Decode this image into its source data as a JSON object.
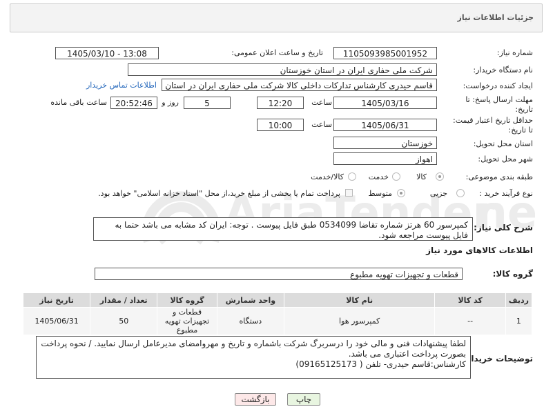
{
  "header": {
    "title": "جزئیات اطلاعات نیاز"
  },
  "fields": {
    "need_number_label": "شماره نیاز:",
    "need_number": "1105093985001952",
    "announce_label": "تاریخ و ساعت اعلان عمومی:",
    "announce_value": "1405/03/10 - 13:08",
    "buyer_org_label": "نام دستگاه خریدار:",
    "buyer_org": "شرکت ملی حفاری ایران در استان خوزستان",
    "creator_label": "ایجاد کننده درخواست:",
    "creator": "قاسم حیدری کارشناس تدارکات داخلی کالا شرکت ملی حفاری ایران در استان خوزستان",
    "contact_link": "اطلاعات تماس خریدار",
    "reply_deadline_label_1": "مهلت ارسال پاسخ: تا",
    "reply_deadline_label_2": "تاریخ:",
    "reply_date": "1405/03/16",
    "time_label": "ساعت",
    "reply_time": "12:20",
    "days_value": "5",
    "days_label": "روز و",
    "remaining_value": "20:52:46",
    "remaining_label": "ساعت باقی مانده",
    "price_validity_label_1": "حداقل تاریخ اعتبار قیمت:",
    "price_validity_label_2": "تا تاریخ:",
    "price_date": "1405/06/31",
    "price_time": "10:00",
    "province_label": "استان محل تحویل:",
    "province": "خوزستان",
    "city_label": "شهر محل تحویل:",
    "city": "اهواز",
    "category_label": "طبقه بندی موضوعی:",
    "category_options": [
      "کالا",
      "خدمت",
      "کالا/خدمت"
    ],
    "process_label": "نوع فرآیند خرید :",
    "process_options": [
      "جزیی",
      "متوسط"
    ],
    "payment_note": "پرداخت تمام یا بخشی از مبلغ خرید،از محل \"اسناد خزانه اسلامی\" خواهد بود."
  },
  "description": {
    "label": "شرح کلی نیاز:",
    "text": "کمپرسور 60 هرتز شماره تقاضا 0534099 طبق فایل پیوست . توجه: ایران کد مشابه می باشد حتما به فایل پیوست مراجعه شود."
  },
  "goods": {
    "section_title": "اطلاعات کالاهای مورد نیاز",
    "group_label": "گروه کالا:",
    "group_value": "قطعات و تجهیزات تهویه مطبوع",
    "columns": [
      "ردیف",
      "کد کالا",
      "نام کالا",
      "واحد شمارش",
      "گروه کالا",
      "تعداد / مقدار",
      "تاریخ نیاز"
    ],
    "rows": [
      {
        "row": "1",
        "code": "--",
        "name": "کمپرسور هوا",
        "unit": "دستگاه",
        "group": "قطعات و تجهیزات تهویه مطبوع",
        "qty": "50",
        "date": "1405/06/31"
      }
    ]
  },
  "buyer_notes": {
    "label": "توضیحات خریدار:",
    "line1": "لطفا پیشنهادات فنی و مالی خود را درسربرگ شرکت باشماره و تاریخ و مهروامضای مدیرعامل ارسال نمایید. / نحوه پرداخت بصورت پرداخت اعتباری می باشد.",
    "line2": "کارشناس:قاسم حیدری- تلفن ( 09165125173)"
  },
  "buttons": {
    "print": "چاپ",
    "back": "بازگشت"
  },
  "colors": {
    "link": "#2266bb",
    "print_bg": "#e8f5e0",
    "back_bg": "#fde8e8",
    "watermark": "#e9e9e9"
  }
}
